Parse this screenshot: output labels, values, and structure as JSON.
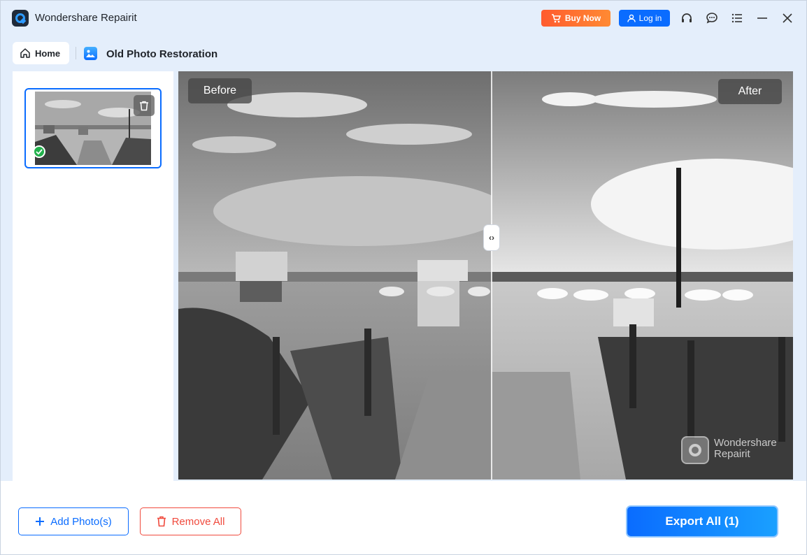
{
  "app": {
    "title": "Wondershare Repairit"
  },
  "titlebar": {
    "buy_now": "Buy Now",
    "log_in": "Log in",
    "icons": [
      "cart-icon",
      "user-icon",
      "headset-icon",
      "chat-icon",
      "menu-icon",
      "minimize-icon",
      "close-icon"
    ]
  },
  "nav": {
    "home": "Home",
    "module": "Old Photo Restoration"
  },
  "preview": {
    "before_label": "Before",
    "after_label": "After",
    "watermark_line1": "Wondershare",
    "watermark_line2": "Repairit",
    "split_handle": "‹›"
  },
  "actions": {
    "add_photos": "Add Photo(s)",
    "remove_all": "Remove All",
    "export_all": "Export All (1)"
  },
  "colors": {
    "accent": "#0a6cff",
    "danger": "#f04a3d",
    "buy": "#ff6a2e",
    "success": "#22b14c"
  }
}
